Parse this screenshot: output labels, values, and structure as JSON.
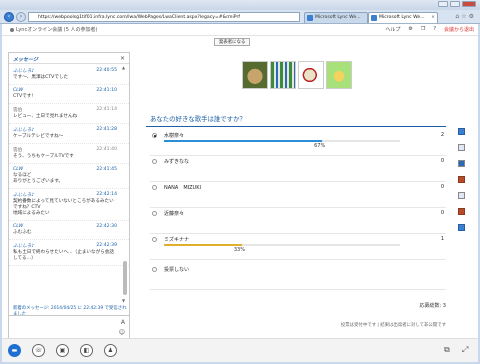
{
  "browser": {
    "address": "https://webpoolsg1tif01.infra.lync.com/lwa/WebPages/LwaClient.aspx?legacy=#&rmiPrf",
    "tabs": [
      {
        "label": "Microsoft Lync We..."
      },
      {
        "label": "Microsoft Lync We..."
      }
    ]
  },
  "app": {
    "title": "Lyncオンライン会議 (5 人の参加者)",
    "help_label": "ヘルプ",
    "leave_label": "会議から退出"
  },
  "presentation": {
    "present_button": "発表者になる"
  },
  "chat": {
    "title": "メッセージ",
    "new_messages": "新着のメッセージ: 2014/04/25 に 22:42:39 で受信されました",
    "messages": [
      {
        "sender": "ふじしろ♪",
        "time": "22:40:55",
        "text": "です〜、黒澤はCTVでした"
      },
      {
        "sender": "CLW",
        "time": "22:41:10",
        "text": "CTVです!"
      },
      {
        "sender": "雲伯",
        "time": "22:41:14",
        "text": "レビュー、土日で見れませんね",
        "grey": true
      },
      {
        "sender": "ふじしろ♪",
        "time": "22:41:28",
        "text": "ケーブルテレビですね〜"
      },
      {
        "sender": "雲伯",
        "time": "22:41:40",
        "text": "そう、うちもケーブルTVです",
        "grey": true
      },
      {
        "sender": "CLW",
        "time": "22:41:45",
        "text": "なるほど\nありがとうございます。"
      },
      {
        "sender": "ふじしろ♪",
        "time": "22:42:14",
        "text": "契約番数によって見ていないところがあるみたいですね？CTV\n地域によるみたい"
      },
      {
        "sender": "CLW",
        "time": "22:42:30",
        "text": "ふむふむ"
      },
      {
        "sender": "ふじしろ♪",
        "time": "22:42:39",
        "text": "私も土日で終わらせたいへ…（止まいながら会話してる…）"
      }
    ]
  },
  "poll": {
    "question": "あなたの好きな歌手は誰ですか？",
    "options": [
      {
        "label": "水樹奈々",
        "count": "2",
        "fraction": 0.67,
        "pct_text": "67%",
        "selected": true,
        "bar_color": "#2a8fd8"
      },
      {
        "label": "みずきなな",
        "count": "0",
        "fraction": 0,
        "pct_text": "",
        "selected": false,
        "bar_color": ""
      },
      {
        "label": "NANA　MIZUKI",
        "count": "0",
        "fraction": 0,
        "pct_text": "",
        "selected": false,
        "bar_color": ""
      },
      {
        "label": "近藤奈々",
        "count": "0",
        "fraction": 0,
        "pct_text": "",
        "selected": false,
        "bar_color": ""
      },
      {
        "label": "ミズキナナ",
        "count": "1",
        "fraction": 0.33,
        "pct_text": "33%",
        "selected": false,
        "bar_color": "#e0b02c"
      },
      {
        "label": "投票しない",
        "count": "",
        "fraction": 0,
        "pct_text": "",
        "selected": false,
        "bar_color": ""
      }
    ],
    "total_label": "応募総数: 3",
    "note": "投票は受付中です | 結果は出席者に対して非公開です"
  },
  "icons": {
    "bottom": [
      "chat-icon",
      "phone-icon",
      "video-icon",
      "share-icon",
      "people-icon"
    ]
  }
}
